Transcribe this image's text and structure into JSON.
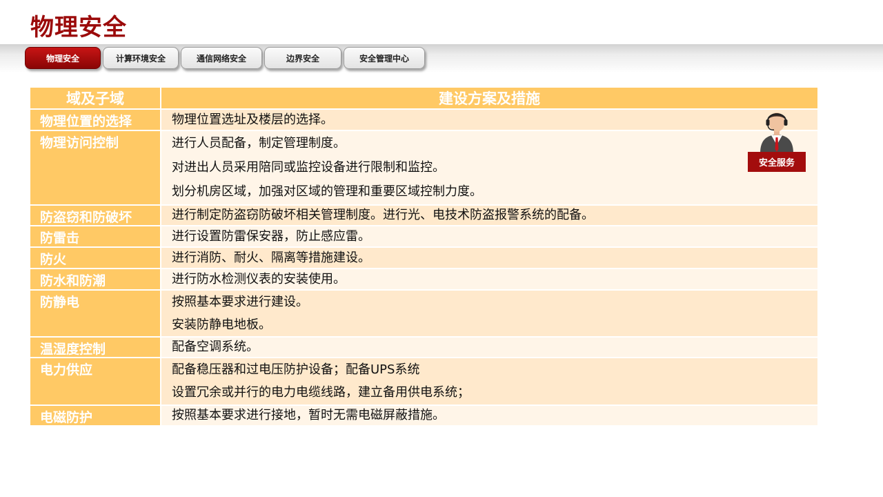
{
  "page": {
    "title": "物理安全"
  },
  "tabs": [
    {
      "label": "物理安全",
      "active": true
    },
    {
      "label": "计算环境安全",
      "active": false
    },
    {
      "label": "通信网络安全",
      "active": false
    },
    {
      "label": "边界安全",
      "active": false
    },
    {
      "label": "安全管理中心",
      "active": false
    }
  ],
  "table": {
    "headers": [
      "域及子域",
      "建设方案及措施"
    ],
    "rows": [
      {
        "domain": "物理位置的选择",
        "measures": [
          "物理位置选址及楼层的选择。"
        ]
      },
      {
        "domain": "物理访问控制",
        "measures": [
          "进行人员配备，制定管理制度。",
          "对进出人员采用陪同或监控设备进行限制和监控。",
          "划分机房区域，加强对区域的管理和重要区域控制力度。"
        ]
      },
      {
        "domain": "防盗窃和防破坏",
        "measures": [
          "进行制定防盗窃防破坏相关管理制度。进行光、电技术防盗报警系统的配备。"
        ]
      },
      {
        "domain": "防雷击",
        "measures": [
          "进行设置防雷保安器，防止感应雷。"
        ]
      },
      {
        "domain": "防火",
        "measures": [
          "进行消防、耐火、隔离等措施建设。"
        ]
      },
      {
        "domain": "防水和防潮",
        "measures": [
          "进行防水检测仪表的安装使用。"
        ]
      },
      {
        "domain": "防静电",
        "measures": [
          "按照基本要求进行建设。",
          "安装防静电地板。"
        ]
      },
      {
        "domain": "温湿度控制",
        "measures": [
          "配备空调系统。"
        ]
      },
      {
        "domain": "电力供应",
        "measures": [
          "配备稳压器和过电压防护设备；配备UPS系统",
          "设置冗余或并行的电力电缆线路，建立备用供电系统；"
        ]
      },
      {
        "domain": "电磁防护",
        "measures": [
          "按照基本要求进行接地，暂时无需电磁屏蔽措施。"
        ]
      }
    ]
  },
  "service_badge": {
    "label": "安全服务",
    "icon": "customer-service-agent-icon"
  },
  "colors": {
    "title": "#9b0a0a",
    "tab_active": "#b30e0e",
    "header_fill": "#ffc965",
    "row_odd": "#ffe9cc",
    "row_even": "#fff5e8",
    "badge": "#a30d0d"
  }
}
